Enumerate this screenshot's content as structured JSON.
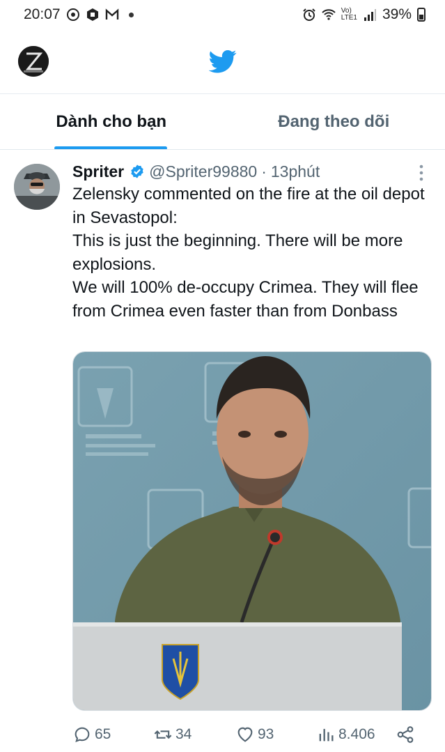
{
  "status_bar": {
    "time": "20:07",
    "left_icons": [
      "settings-circle-icon",
      "hexagon-app-icon",
      "gmail-icon"
    ],
    "right_icons": [
      "alarm-icon",
      "wifi-icon",
      "signal-icon"
    ],
    "network_label_top": "Vo)",
    "network_label_bottom": "LTE1",
    "battery": "39%"
  },
  "header": {
    "logo": "twitter-bird-icon",
    "logo_color": "#1d9bf0"
  },
  "tabs": [
    {
      "label": "Dành cho bạn",
      "active": true
    },
    {
      "label": "Đang theo dõi",
      "active": false
    }
  ],
  "tweet": {
    "author_name": "Spriter",
    "handle": "@Spriter99880",
    "separator": "·",
    "time": "13phút",
    "verified": true,
    "text_lines": [
      "Zelensky commented on the fire at the oil depot in Sevastopol:",
      "This is just the beginning. There will be more explosions.",
      "We will 100% de-occupy Crimea. They will flee from Crimea even faster than from Donbass"
    ],
    "actions": {
      "replies": "65",
      "retweets": "34",
      "likes": "93",
      "views": "8.406"
    }
  },
  "colors": {
    "accent": "#1d9bf0",
    "text_primary": "#0f1419",
    "text_secondary": "#536471"
  }
}
